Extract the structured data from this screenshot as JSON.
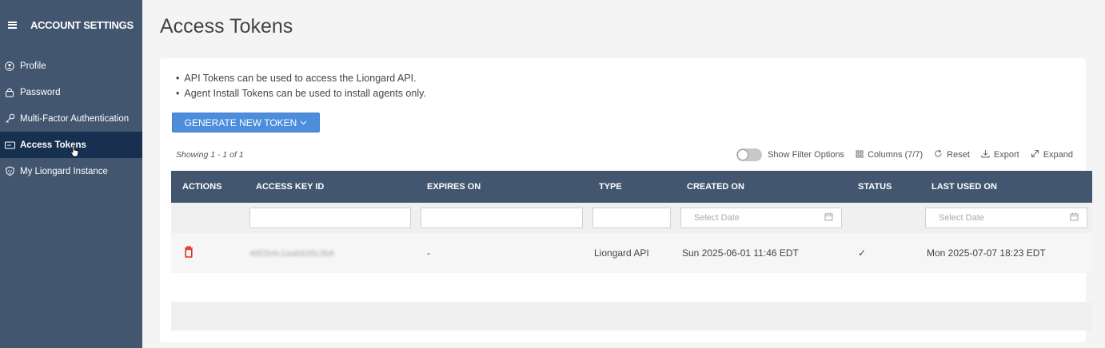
{
  "sidebar": {
    "title": "ACCOUNT SETTINGS",
    "items": [
      {
        "label": "Profile",
        "icon": "user-icon"
      },
      {
        "label": "Password",
        "icon": "lock-icon"
      },
      {
        "label": "Multi-Factor Authentication",
        "icon": "key-icon"
      },
      {
        "label": "Access Tokens",
        "icon": "ticket-icon",
        "active": true
      },
      {
        "label": "My Liongard Instance",
        "icon": "lion-icon"
      }
    ]
  },
  "page": {
    "title": "Access Tokens",
    "info": [
      "API Tokens can be used to access the Liongard API.",
      "Agent Install Tokens can be used to install agents only."
    ],
    "generate_button": "GENERATE NEW TOKEN",
    "showing": "Showing 1 - 1 of 1"
  },
  "toolbar": {
    "show_filter": "Show Filter Options",
    "columns": "Columns (7/7)",
    "reset": "Reset",
    "export": "Export",
    "expand": "Expand"
  },
  "table": {
    "headers": [
      "ACTIONS",
      "ACCESS KEY ID",
      "EXPIRES ON",
      "TYPE",
      "CREATED ON",
      "STATUS",
      "LAST USED ON"
    ],
    "date_placeholder": "Select Date",
    "rows": [
      {
        "access_key_id": "48f2b4c1aab926c3b6",
        "expires_on": "-",
        "type": "Liongard API",
        "created_on": "Sun 2025-06-01 11:46 EDT",
        "status": "✓",
        "last_used_on": "Mon 2025-07-07 18:23 EDT"
      }
    ]
  },
  "colors": {
    "sidebar_bg": "#425670",
    "sidebar_active": "#17304f",
    "accent": "#4d8ddb",
    "delete": "#d9341c"
  }
}
